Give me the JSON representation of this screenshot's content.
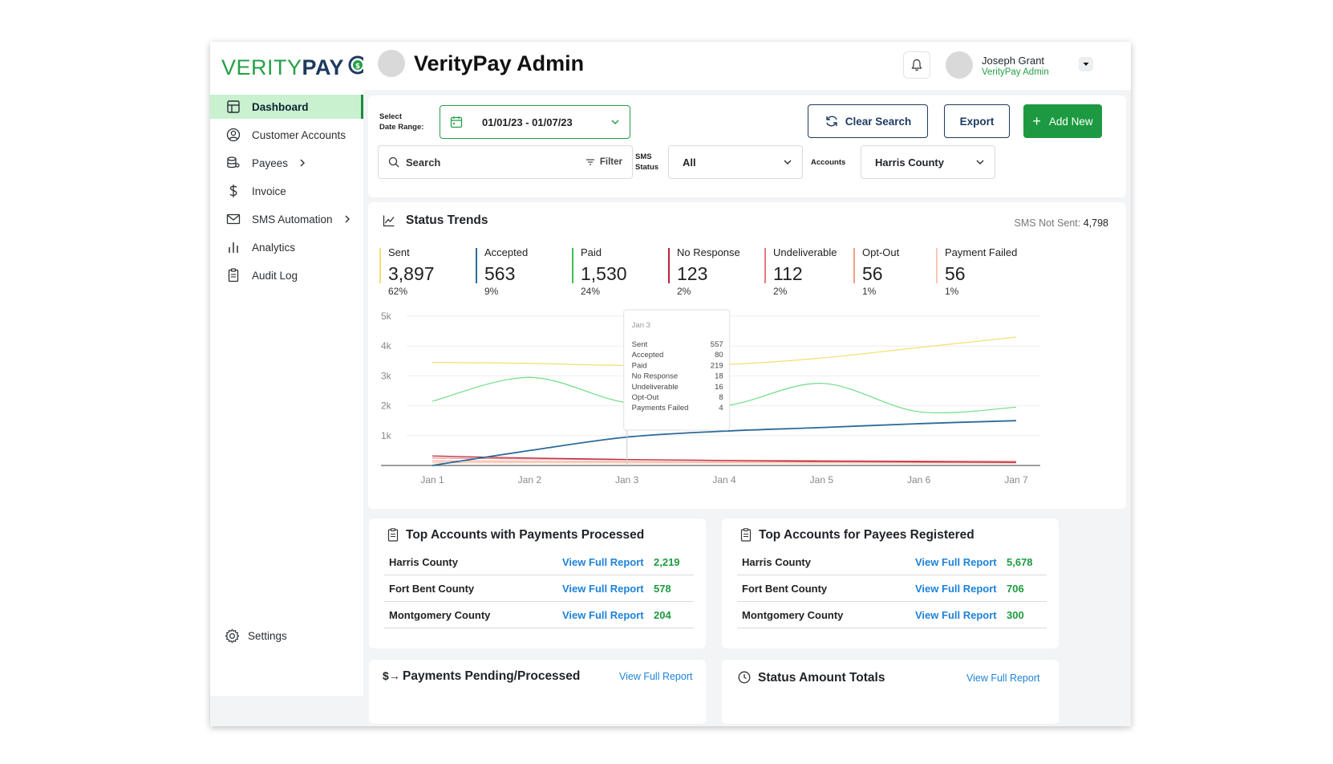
{
  "brand": {
    "verity": "VERITY",
    "pay": "PAY"
  },
  "colors": {
    "green": "#25a047",
    "navy": "#1d3a5f",
    "link": "#1e82d9"
  },
  "sidebar": {
    "items": [
      {
        "label": "Dashboard",
        "icon": "dashboard-icon",
        "active": true
      },
      {
        "label": "Customer Accounts",
        "icon": "user-circle-icon"
      },
      {
        "label": "Payees",
        "icon": "database-user-icon",
        "has_children": true
      },
      {
        "label": "Invoice",
        "icon": "dollar-icon"
      },
      {
        "label": "SMS Automation",
        "icon": "mail-icon",
        "has_children": true
      },
      {
        "label": "Analytics",
        "icon": "bar-chart-icon"
      },
      {
        "label": "Audit Log",
        "icon": "clipboard-icon"
      }
    ],
    "settings_label": "Settings"
  },
  "header": {
    "title": "VerityPay Admin",
    "user_name": "Joseph Grant",
    "user_role": "VerityPay Admin"
  },
  "filters": {
    "date_label_1": "Select",
    "date_label_2": "Date Range:",
    "date_value": "01/01/23 - 01/07/23",
    "clear_label": "Clear Search",
    "export_label": "Export",
    "add_label": "Add New",
    "search_placeholder": "Search",
    "filter_label": "Filter",
    "sms_label_1": "SMS",
    "sms_label_2": "Status",
    "sms_value": "All",
    "accounts_label": "Accounts",
    "accounts_value": "Harris County"
  },
  "trends": {
    "title": "Status Trends",
    "sms_not_sent_label": "SMS Not Sent:",
    "sms_not_sent_value": "4,798",
    "stats": [
      {
        "label": "Sent",
        "value": "3,897",
        "pct": "62%",
        "color": "#f2df6b"
      },
      {
        "label": "Accepted",
        "value": "563",
        "pct": "9%",
        "color": "#2c6b9a"
      },
      {
        "label": "Paid",
        "value": "1,530",
        "pct": "24%",
        "color": "#3fbf5a"
      },
      {
        "label": "No Response",
        "value": "123",
        "pct": "2%",
        "color": "#b5223a"
      },
      {
        "label": "Undeliverable",
        "value": "112",
        "pct": "2%",
        "color": "#e67b7b"
      },
      {
        "label": "Opt-Out",
        "value": "56",
        "pct": "1%",
        "color": "#f1a08a"
      },
      {
        "label": "Payment Failed",
        "value": "56",
        "pct": "1%",
        "color": "#f7c9b3"
      }
    ]
  },
  "chart_data": {
    "type": "line",
    "x": [
      "Jan 1",
      "Jan 2",
      "Jan 3",
      "Jan 4",
      "Jan 5",
      "Jan 6",
      "Jan 7"
    ],
    "ylim": [
      0,
      5000
    ],
    "yticks": [
      "5k",
      "4k",
      "3k",
      "2k",
      "1k"
    ],
    "series": [
      {
        "name": "Sent",
        "color": "#f2df6b",
        "values": [
          3450,
          3420,
          3350,
          3380,
          3600,
          3950,
          4300
        ]
      },
      {
        "name": "Paid",
        "color": "#6fdc85",
        "values": [
          2150,
          2950,
          2100,
          2000,
          2750,
          1800,
          1950
        ]
      },
      {
        "name": "Accepted",
        "color": "#2c6b9a",
        "values": [
          0,
          500,
          950,
          1150,
          1270,
          1400,
          1500
        ]
      },
      {
        "name": "No Response",
        "color": "#b5223a",
        "values": [
          320,
          250,
          200,
          170,
          140,
          120,
          100
        ]
      },
      {
        "name": "Undeliverable",
        "color": "#e67b7b",
        "values": [
          250,
          220,
          190,
          170,
          160,
          150,
          140
        ]
      },
      {
        "name": "Opt-Out",
        "color": "#f1a08a",
        "values": [
          150,
          140,
          130,
          120,
          120,
          115,
          110
        ]
      },
      {
        "name": "Payment Failed",
        "color": "#f7c9b3",
        "values": [
          90,
          90,
          85,
          85,
          80,
          80,
          80
        ]
      }
    ],
    "tooltip": {
      "date": "Jan 3",
      "rows": [
        {
          "label": "Sent",
          "value": "557"
        },
        {
          "label": "Accepted",
          "value": "80"
        },
        {
          "label": "Paid",
          "value": "219"
        },
        {
          "label": "No Response",
          "value": "18"
        },
        {
          "label": "Undeliverable",
          "value": "16"
        },
        {
          "label": "Opt-Out",
          "value": "8"
        },
        {
          "label": "Payments Failed",
          "value": "4"
        }
      ]
    }
  },
  "top_payments": {
    "title": "Top Accounts with Payments Processed",
    "rows": [
      {
        "name": "Harris County",
        "link": "View Full Report",
        "value": "2,219"
      },
      {
        "name": "Fort Bent County",
        "link": "View Full Report",
        "value": "578"
      },
      {
        "name": "Montgomery County",
        "link": "View Full Report",
        "value": "204"
      }
    ]
  },
  "top_payees": {
    "title": "Top Accounts for Payees Registered",
    "rows": [
      {
        "name": "Harris County",
        "link": "View Full Report",
        "value": "5,678"
      },
      {
        "name": "Fort Bent County",
        "link": "View Full Report",
        "value": "706"
      },
      {
        "name": "Montgomery County",
        "link": "View Full Report",
        "value": "300"
      }
    ]
  },
  "payments_pending": {
    "title": "Payments Pending/Processed",
    "link": "View Full Report"
  },
  "status_amounts": {
    "title": "Status Amount Totals",
    "link": "View Full Report"
  }
}
